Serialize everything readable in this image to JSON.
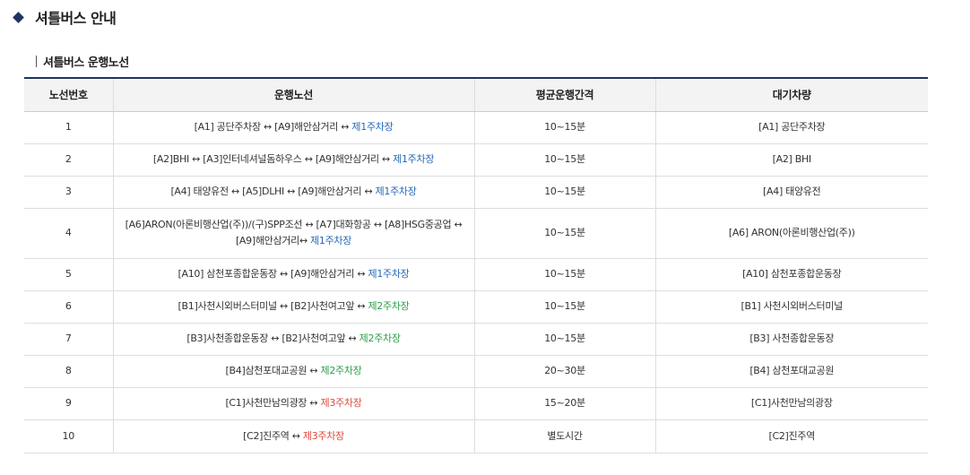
{
  "page_title": "셔틀버스 안내",
  "section_title": "셔틀버스 운행노선",
  "table": {
    "headers": [
      "노선번호",
      "운행노선",
      "평균운행간격",
      "대기차량"
    ],
    "rows": [
      {
        "no": "1",
        "route": "[A1] 공단주차장 ↔ [A9]해안삼거리 ↔ ",
        "lot": "제1주차장",
        "lot_color": "#2467b8",
        "interval": "10~15분",
        "standby": "[A1] 공단주차장"
      },
      {
        "no": "2",
        "route": "[A2]BHI ↔ [A3]인터네셔널돔하우스 ↔ [A9]해안삼거리 ↔ ",
        "lot": "제1주차장",
        "lot_color": "#2467b8",
        "interval": "10~15분",
        "standby": "[A2] BHI"
      },
      {
        "no": "3",
        "route": "[A4] 태양유전 ↔ [A5]DLHI ↔ [A9]해안삼거리 ↔ ",
        "lot": "제1주차장",
        "lot_color": "#2467b8",
        "interval": "10~15분",
        "standby": "[A4] 태양유전"
      },
      {
        "no": "4",
        "route": "[A6]ARON(아론비행산업(주))/(구)SPP조선 ↔ [A7]대화항공 ↔ [A8]HSG중공업 ↔\n[A9]해안삼거리↔ ",
        "lot": "제1주차장",
        "lot_color": "#2467b8",
        "interval": "10~15분",
        "standby": "[A6] ARON(아론비행산업(주))"
      },
      {
        "no": "5",
        "route": "[A10] 삼천포종합운동장 ↔ [A9]해안삼거리 ↔ ",
        "lot": "제1주차장",
        "lot_color": "#2467b8",
        "interval": "10~15분",
        "standby": "[A10] 삼천포종합운동장"
      },
      {
        "no": "6",
        "route": "[B1]사천시외버스터미널 ↔ [B2]사천여고앞 ↔ ",
        "lot": "제2주차장",
        "lot_color": "#28a046",
        "interval": "10~15분",
        "standby": "[B1] 사천시외버스터미널"
      },
      {
        "no": "7",
        "route": "[B3]사천종합운동장 ↔ [B2]사천여고앞 ↔ ",
        "lot": "제2주차장",
        "lot_color": "#28a046",
        "interval": "10~15분",
        "standby": "[B3] 사천종합운동장"
      },
      {
        "no": "8",
        "route": "[B4]삼천포대교공원 ↔ ",
        "lot": "제2주차장",
        "lot_color": "#28a046",
        "interval": "20~30분",
        "standby": "[B4] 삼천포대교공원"
      },
      {
        "no": "9",
        "route": "[C1]사천만남의광장 ↔ ",
        "lot": "제3주차장",
        "lot_color": "#e04a3a",
        "interval": "15~20분",
        "standby": "[C1]사천만남의광장"
      },
      {
        "no": "10",
        "route": "[C2]진주역 ↔ ",
        "lot": "제3주차장",
        "lot_color": "#e04a3a",
        "interval": "별도시간",
        "standby": "[C2]진주역"
      }
    ]
  },
  "colors": {
    "accent_navy": "#1e3461",
    "lot_1": "#2467b8",
    "lot_2": "#28a046",
    "lot_3": "#e04a3a"
  }
}
